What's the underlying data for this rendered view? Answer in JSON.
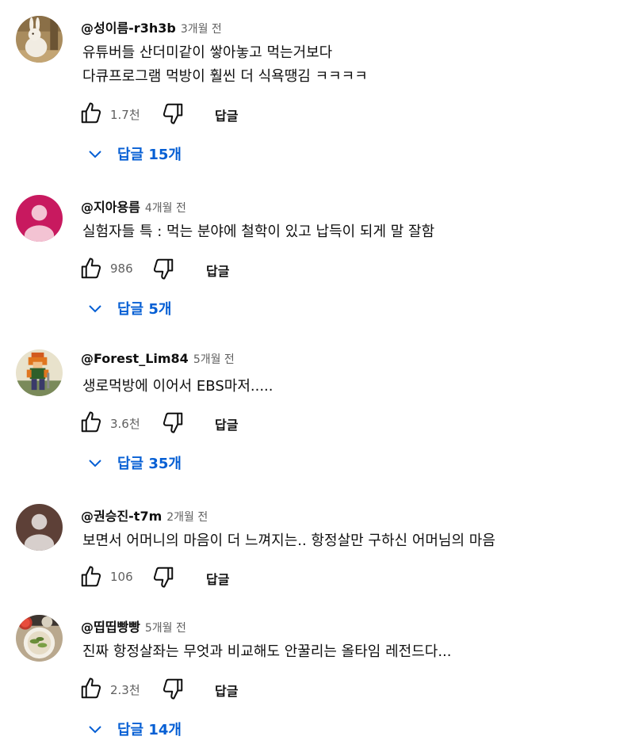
{
  "comments": [
    {
      "author": "@성이름-r3h3b",
      "time": "3개월 전",
      "text": "유튜버들 산더미같이 쌓아놓고 먹는거보다\n다큐프로그램 먹방이 훨씬 더 식욕땡김 ㅋㅋㅋㅋ",
      "likes": "1.7천",
      "reply_label": "답글",
      "replies": "답글 15개",
      "avatar": "rabbit-avatar"
    },
    {
      "author": "@지아용름",
      "time": "4개월 전",
      "text": "실험자들 특 : 먹는 분야에 철학이 있고 납득이 되게 말 잘함",
      "likes": "986",
      "reply_label": "답글",
      "replies": "답글 5개",
      "avatar": "default-avatar-pink"
    },
    {
      "author": "@Forest_Lim84",
      "time": "5개월 전",
      "text": "생로먹방에 이어서 EBS마저.....",
      "likes": "3.6천",
      "reply_label": "답글",
      "replies": "답글 35개",
      "avatar": "pixel-character-avatar"
    },
    {
      "author": "@권승진-t7m",
      "time": "2개월 전",
      "text": "보면서 어머니의 마음이 더 느껴지는.. 항정살만 구하신 어머님의 마음",
      "likes": "106",
      "reply_label": "답글",
      "replies": "",
      "avatar": "default-avatar-brown"
    },
    {
      "author": "@띱띱빵빵",
      "time": "5개월 전",
      "text": "진짜 항정살좌는 무엇과 비교해도 안꿀리는 올타임 레전드다...",
      "likes": "2.3천",
      "reply_label": "답글",
      "replies": "답글 14개",
      "avatar": "food-photo-avatar"
    }
  ],
  "colors": {
    "text": "#0f0f0f",
    "secondary": "#606060",
    "link": "#065fd4",
    "avatar_pink": "#c8195f",
    "avatar_brown": "#5d4037"
  },
  "icons": {
    "like": "thumbs-up-icon",
    "dislike": "thumbs-down-icon",
    "replies": "chevron-down-icon"
  }
}
